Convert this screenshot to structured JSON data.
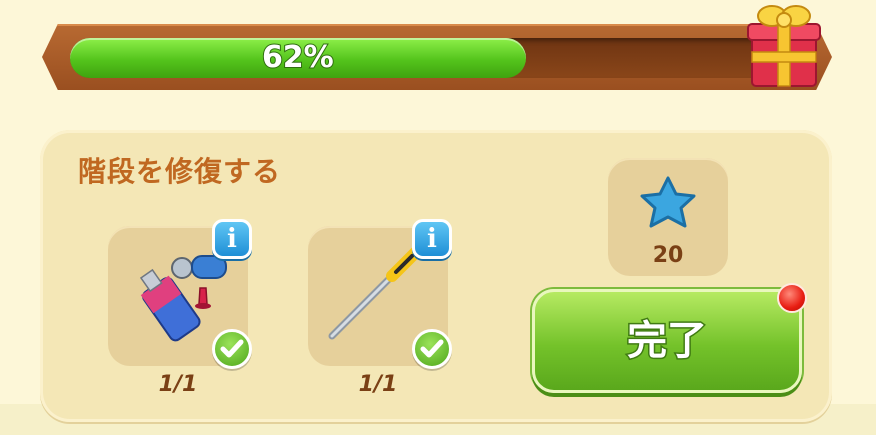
{
  "progress": {
    "percent": 62,
    "label": "62%",
    "fill_color": "#54c41c"
  },
  "gift": {
    "icon": "gift-box-icon"
  },
  "task": {
    "title": "階段を修復する",
    "items": [
      {
        "icon": "glue-tube-and-roller-icon",
        "count": "1/1",
        "completed": true
      },
      {
        "icon": "screwdriver-icon",
        "count": "1/1",
        "completed": true
      }
    ],
    "reward": {
      "icon": "blue-star-icon",
      "value": "20"
    },
    "complete_button": {
      "label": "完了"
    }
  }
}
